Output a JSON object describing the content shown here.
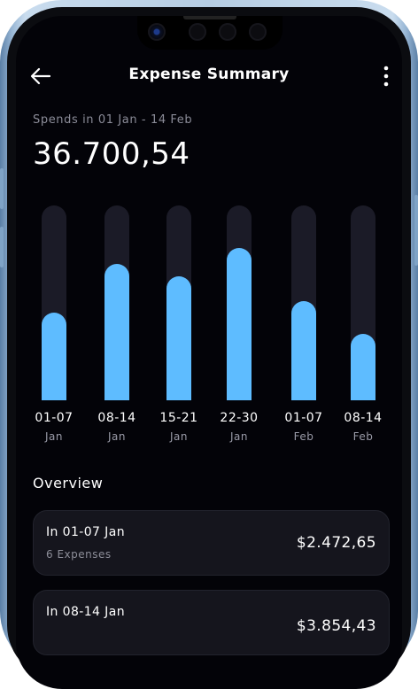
{
  "header": {
    "title": "Expense Summary",
    "back_icon": "arrow-left-icon",
    "menu_icon": "more-vertical-icon"
  },
  "summary": {
    "period_label": "Spends in 01 Jan - 14 Feb",
    "total": "36.700,54"
  },
  "chart_data": {
    "type": "bar",
    "categories": [
      "01-07 Jan",
      "08-14 Jan",
      "15-21 Jan",
      "22-30 Jan",
      "01-07 Feb",
      "08-14 Feb"
    ],
    "range_labels": [
      "01-07",
      "08-14",
      "15-21",
      "22-30",
      "01-07",
      "08-14"
    ],
    "month_labels": [
      "Jan",
      "Jan",
      "Jan",
      "Jan",
      "Feb",
      "Feb"
    ],
    "values": [
      2472.65,
      3854.43,
      3500,
      4300,
      2800,
      1880
    ],
    "ylim": [
      0,
      5500
    ],
    "colors": {
      "bar": "#5ebcff",
      "track": "#1b1b27"
    }
  },
  "overview": {
    "heading": "Overview",
    "cards": [
      {
        "range": "In 01-07 Jan",
        "count": "6 Expenses",
        "amount": "$2.472,65"
      },
      {
        "range": "In 08-14 Jan",
        "count": "",
        "amount": "$3.854,43"
      }
    ]
  }
}
